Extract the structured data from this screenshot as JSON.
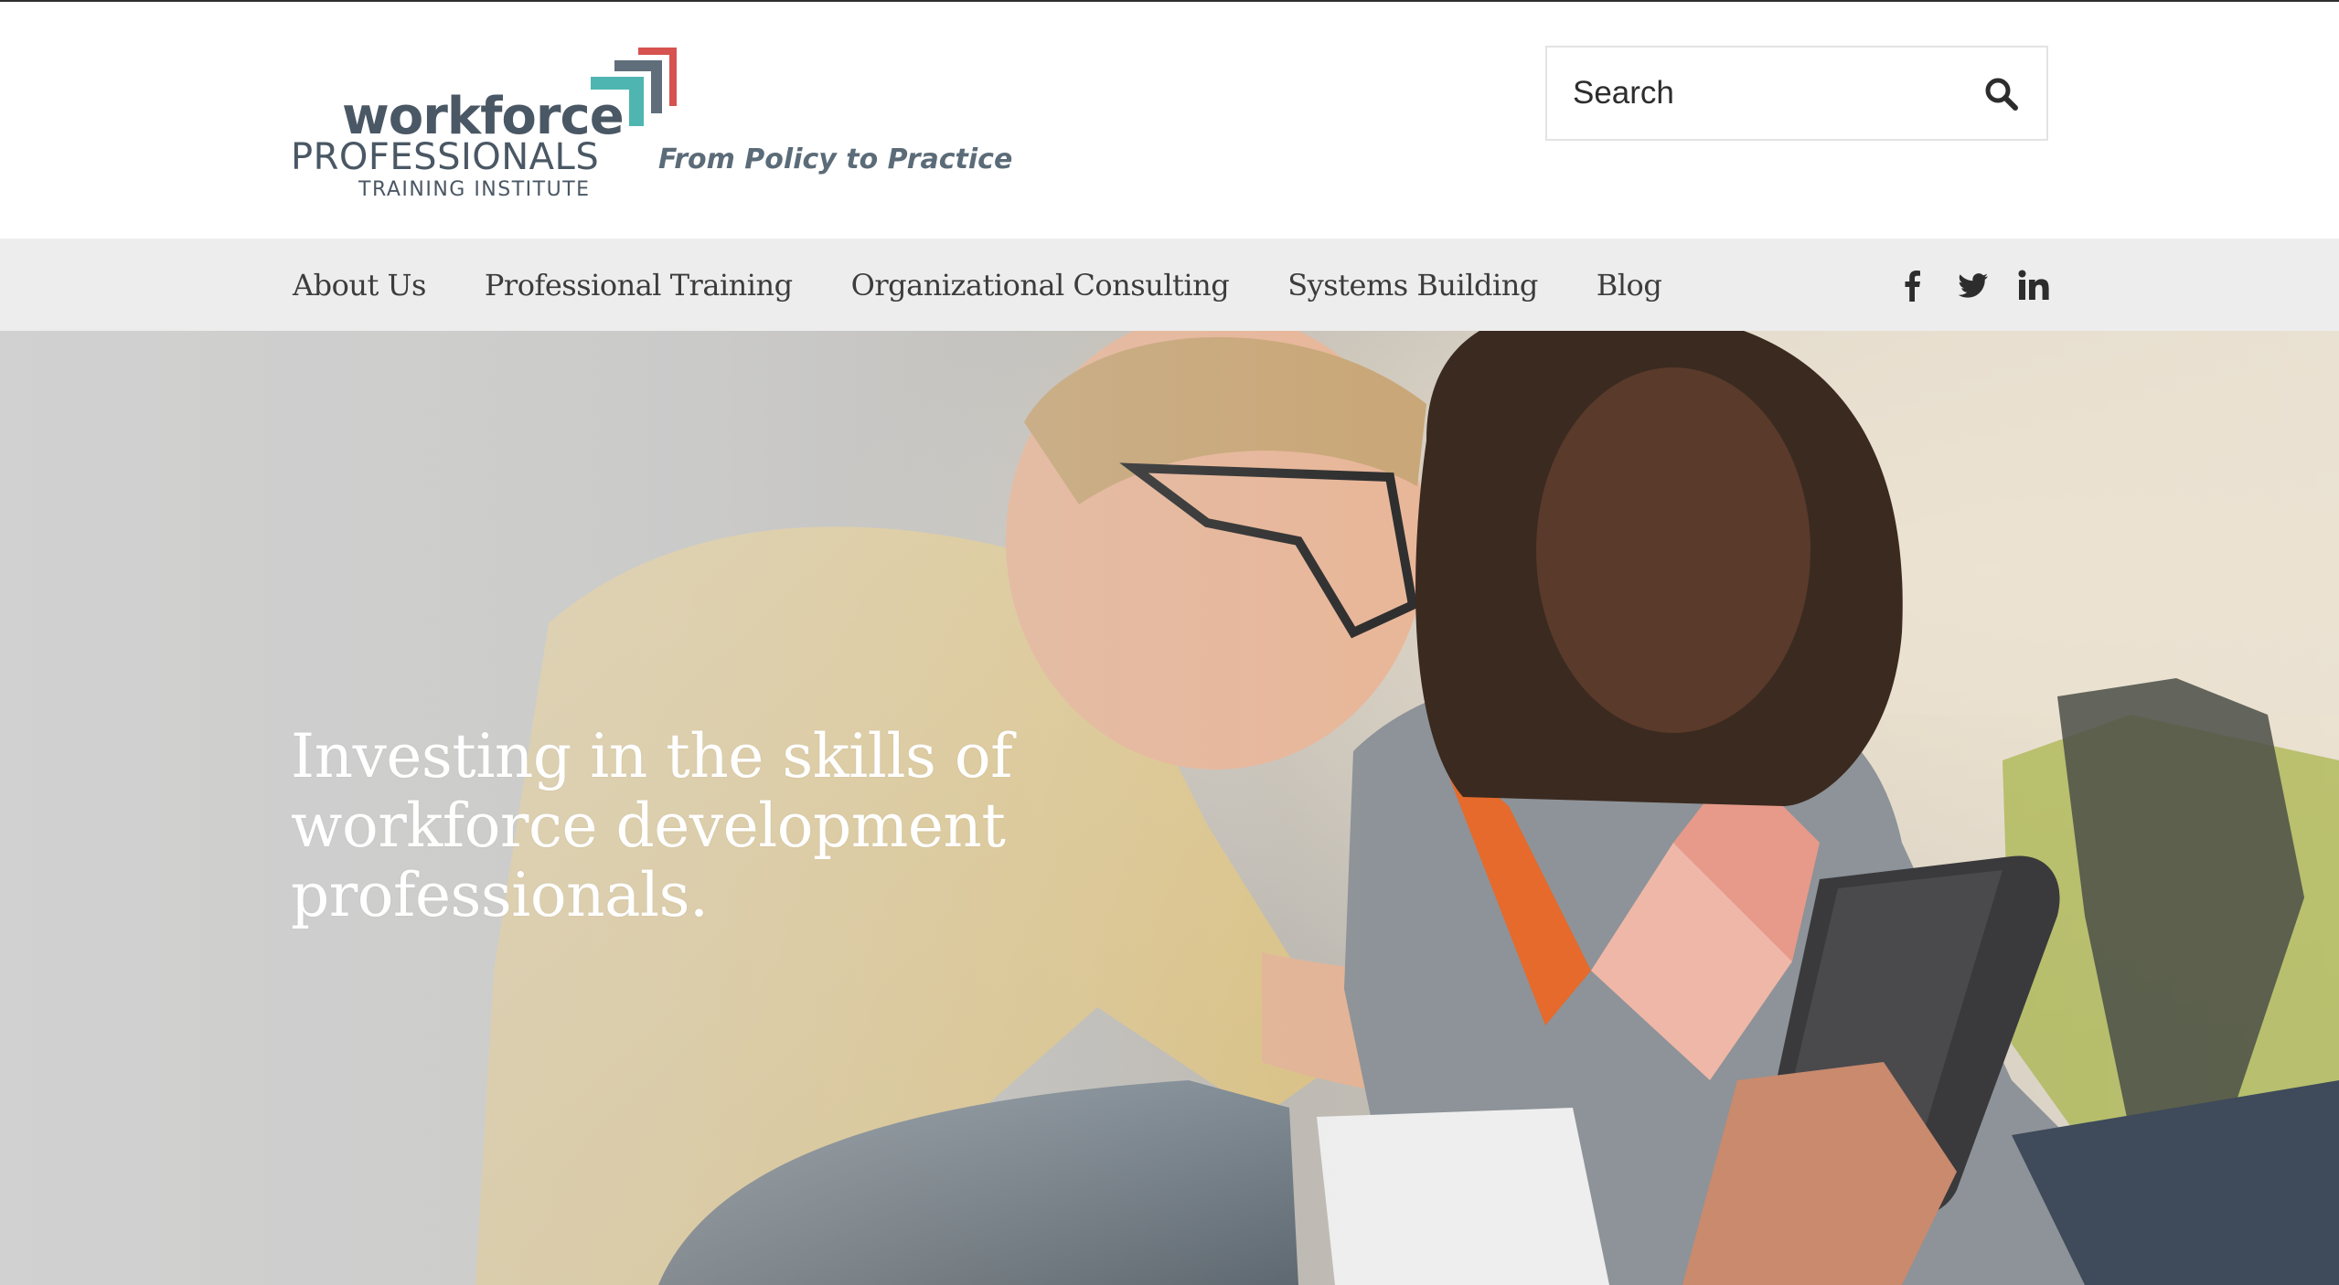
{
  "header": {
    "logo": {
      "word": "workforce",
      "line2": "PROFESSIONALS",
      "line3": "TRAINING INSTITUTE"
    },
    "tagline": "From Policy to Practice",
    "search": {
      "placeholder": "Search",
      "icon": "search-icon"
    }
  },
  "nav": {
    "items": [
      {
        "label": "About Us"
      },
      {
        "label": "Professional Training"
      },
      {
        "label": "Organizational Consulting"
      },
      {
        "label": "Systems Building"
      },
      {
        "label": "Blog"
      }
    ],
    "social": [
      {
        "icon": "facebook-icon"
      },
      {
        "icon": "twitter-icon"
      },
      {
        "icon": "linkedin-icon"
      }
    ]
  },
  "hero": {
    "title": "Investing in the skills of workforce development professionals."
  },
  "colors": {
    "logo_text": "#4a5764",
    "logo_teal": "#4fb5b0",
    "logo_slate": "#5f6e7a",
    "logo_red": "#d6534f",
    "nav_bg": "#ededed",
    "nav_text": "#3c3c3c",
    "hero_text": "#ffffff"
  }
}
